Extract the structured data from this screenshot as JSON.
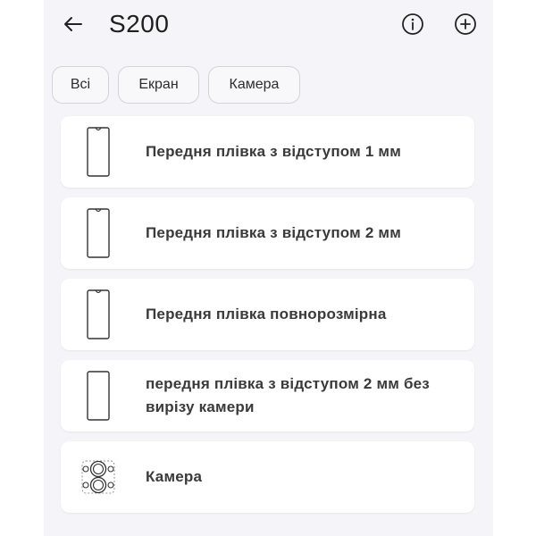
{
  "header": {
    "title": "S200",
    "back_icon": "arrow-left-icon",
    "info_icon": "info-circle-icon",
    "add_icon": "plus-circle-icon"
  },
  "filters": [
    {
      "label": "Всі"
    },
    {
      "label": "Екран"
    },
    {
      "label": "Камера"
    }
  ],
  "items": [
    {
      "label": "Передня плівка з відступом 1 мм",
      "icon": "phone-outline-icon"
    },
    {
      "label": "Передня плівка з відступом 2 мм",
      "icon": "phone-outline-icon"
    },
    {
      "label": "Передня плівка повнорозмірна",
      "icon": "phone-outline-icon"
    },
    {
      "label": "передня плівка з відступом 2 мм без вирізу камери",
      "icon": "phone-outline-icon"
    },
    {
      "label": "Камера",
      "icon": "camera-lens-icon"
    }
  ],
  "colors": {
    "background": "#f5f4f8",
    "card": "#ffffff",
    "text": "#3a3a3a"
  }
}
